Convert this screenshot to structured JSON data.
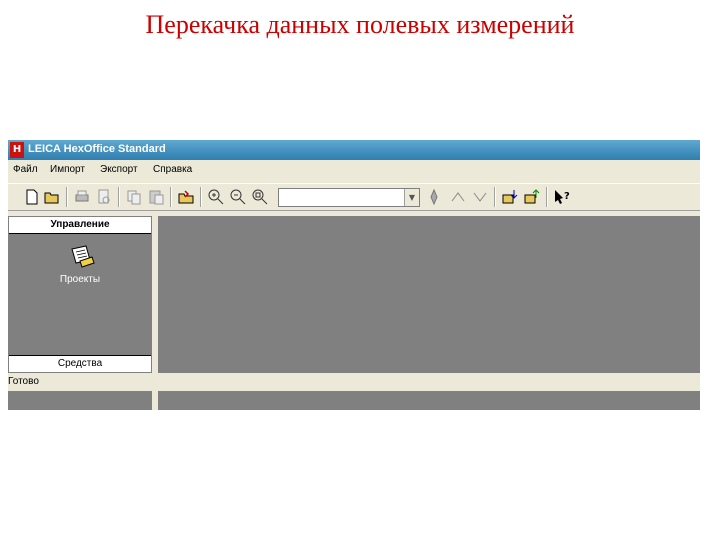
{
  "slide": {
    "title": "Перекачка данных полевых измерений"
  },
  "window": {
    "logo": "H",
    "title": "LEICA HexOffice   Standard"
  },
  "menu": [
    "Файл",
    "Импорт",
    "Экспорт",
    "Справка"
  ],
  "toolbar": {
    "buttons": [
      "new-icon",
      "open-icon",
      "print-icon",
      "print-preview-icon",
      "copy-icon",
      "paste-icon",
      "import-folder-icon",
      "zoom-in-icon",
      "zoom-out-icon",
      "zoom-fit-icon",
      "navigate-icon",
      "measure-icon",
      "measure-alt-icon",
      "transfer-in-icon",
      "transfer-out-icon",
      "help-icon"
    ],
    "combo_value": ""
  },
  "left_panel": {
    "header": "Управление",
    "project_label": "Проекты",
    "footer": "Средства"
  },
  "status": {
    "text": "Готово"
  },
  "colors": {
    "title_red": "#cc0000",
    "panel_gray": "#808080",
    "chrome": "#ece9d8"
  }
}
